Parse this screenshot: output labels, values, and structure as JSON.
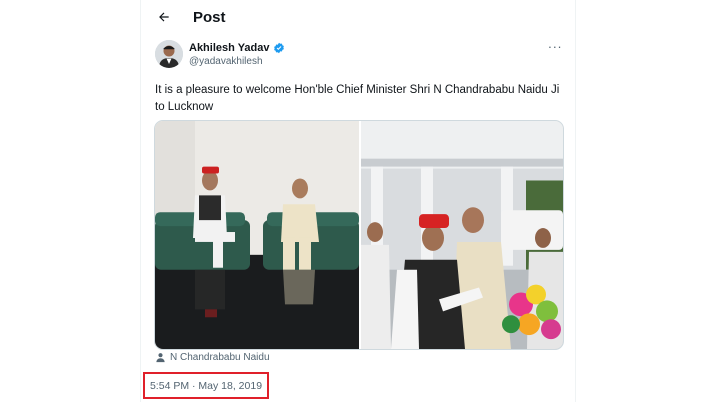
{
  "header": {
    "title": "Post",
    "back_icon": "arrow-left-icon"
  },
  "tweet": {
    "author": {
      "display_name": "Akhilesh Yadav",
      "handle": "@yadavakhilesh",
      "verified": true,
      "verified_color": "#1d9bf0"
    },
    "more_icon": "more-horizontal-icon",
    "text": "It is a pleasure to welcome Hon'ble Chief Minister Shri N Chandrababu Naidu Ji to Lucknow",
    "media": [
      {
        "description_icon": "photo-two-men-seated-on-green-sofa"
      },
      {
        "description_icon": "photo-two-men-embracing-with-bouquet"
      }
    ],
    "tagged_person": "N Chandrababu Naidu",
    "timestamp": "5:54 PM · May 18, 2019",
    "highlight_color": "#e0202a"
  }
}
